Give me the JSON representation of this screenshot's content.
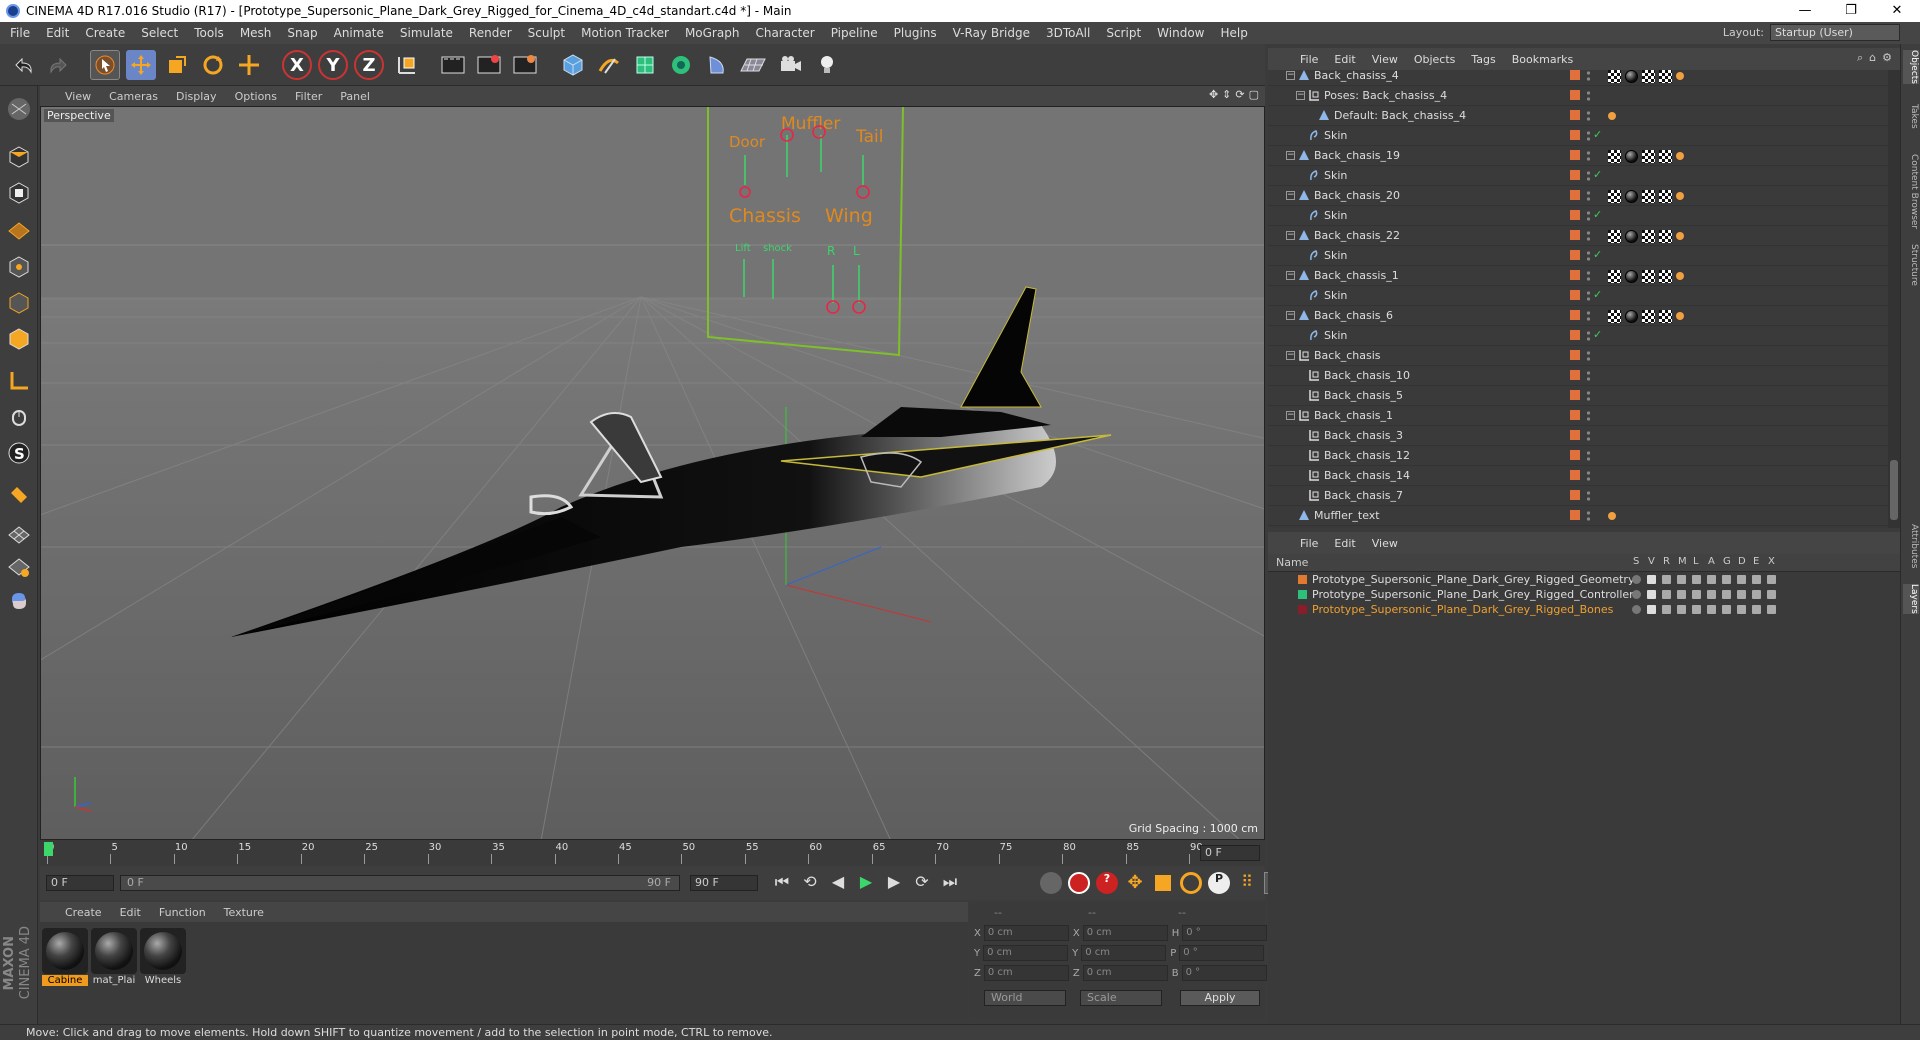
{
  "window": {
    "title": "CINEMA 4D R17.016 Studio (R17) - [Prototype_Supersonic_Plane_Dark_Grey_Rigged_for_Cinema_4D_c4d_standart.c4d *] - Main",
    "minimize": "—",
    "restore": "❐",
    "close": "✕"
  },
  "menubar": {
    "items": [
      "File",
      "Edit",
      "Create",
      "Select",
      "Tools",
      "Mesh",
      "Snap",
      "Animate",
      "Simulate",
      "Render",
      "Sculpt",
      "Motion Tracker",
      "MoGraph",
      "Character",
      "Pipeline",
      "Plugins",
      "V-Ray Bridge",
      "3DToAll",
      "Script",
      "Window",
      "Help"
    ],
    "layout_label": "Layout:",
    "layout_value": "Startup (User)"
  },
  "toolbar": {
    "icons": [
      "undo-icon",
      "redo-icon",
      "select-icon",
      "move-icon",
      "scale-icon",
      "rotate-icon",
      "move-add-icon",
      "x-axis-icon",
      "y-axis-icon",
      "z-axis-icon",
      "coord-system-icon",
      "render-view-icon",
      "render-picture-viewer-icon",
      "edit-render-settings-icon",
      "cube-icon",
      "pen-icon",
      "subdivision-icon",
      "cloner-icon",
      "deformer-icon",
      "floor-icon",
      "camera-icon",
      "light-icon"
    ],
    "axis_labels": [
      "X",
      "Y",
      "Z"
    ]
  },
  "viewport": {
    "menu": [
      "View",
      "Cameras",
      "Display",
      "Options",
      "Filter",
      "Panel"
    ],
    "label": "Perspective",
    "grid_spacing": "Grid Spacing : 1000 cm",
    "control_labels": {
      "muffler": "Muffler",
      "door": "Door",
      "tail": "Tail",
      "chassis": "Chassis",
      "wing": "Wing",
      "lift": "Lift",
      "shock": "shock",
      "r": "R",
      "l": "L"
    }
  },
  "timeline": {
    "ticks": [
      "0",
      "5",
      "10",
      "15",
      "20",
      "25",
      "30",
      "35",
      "40",
      "45",
      "50",
      "55",
      "60",
      "65",
      "70",
      "75",
      "80",
      "85",
      "90"
    ],
    "current_frame": "0 F",
    "start": "0 F",
    "range_start": "0 F",
    "range_end": "90 F",
    "end": "90 F"
  },
  "materials": {
    "menu": [
      "Create",
      "Edit",
      "Function",
      "Texture"
    ],
    "items": [
      {
        "label": "Cabine",
        "selected": true
      },
      {
        "label": "mat_Plai",
        "selected": false
      },
      {
        "label": "Wheels",
        "selected": false
      }
    ]
  },
  "coords": {
    "headers": [
      "--",
      "--",
      "--"
    ],
    "rows": [
      {
        "a": "X",
        "av": "0 cm",
        "b": "X",
        "bv": "0 cm",
        "c": "H",
        "cv": "0 °"
      },
      {
        "a": "Y",
        "av": "0 cm",
        "b": "Y",
        "bv": "0 cm",
        "c": "P",
        "cv": "0 °"
      },
      {
        "a": "Z",
        "av": "0 cm",
        "b": "Z",
        "bv": "0 cm",
        "c": "B",
        "cv": "0 °"
      }
    ],
    "mode1": "World",
    "mode2": "Scale",
    "apply": "Apply"
  },
  "status": "Move: Click and drag to move elements. Hold down SHIFT to quantize movement / add to the selection in point mode, CTRL to remove.",
  "maxon": "MAXON",
  "cinema": "CINEMA 4D",
  "objects": {
    "menu": [
      "File",
      "Edit",
      "View",
      "Objects",
      "Tags",
      "Bookmarks"
    ],
    "rows": [
      {
        "name": "Back_chasiss_4",
        "indent": 1,
        "type": "bone",
        "tags": "full",
        "check": false,
        "exp": "-"
      },
      {
        "name": "Poses: Back_chasiss_4",
        "indent": 2,
        "type": "null",
        "tags": "",
        "check": false,
        "exp": "-"
      },
      {
        "name": "Default: Back_chasiss_4",
        "indent": 3,
        "type": "bone",
        "tags": "or",
        "check": false,
        "exp": ""
      },
      {
        "name": "Skin",
        "indent": 2,
        "type": "skin",
        "tags": "",
        "check": true,
        "exp": ""
      },
      {
        "name": "Back_chasis_19",
        "indent": 1,
        "type": "bone",
        "tags": "full",
        "check": false,
        "exp": "-"
      },
      {
        "name": "Skin",
        "indent": 2,
        "type": "skin",
        "tags": "",
        "check": true,
        "exp": ""
      },
      {
        "name": "Back_chasis_20",
        "indent": 1,
        "type": "bone",
        "tags": "full",
        "check": false,
        "exp": "-"
      },
      {
        "name": "Skin",
        "indent": 2,
        "type": "skin",
        "tags": "",
        "check": true,
        "exp": ""
      },
      {
        "name": "Back_chasis_22",
        "indent": 1,
        "type": "bone",
        "tags": "full",
        "check": false,
        "exp": "-"
      },
      {
        "name": "Skin",
        "indent": 2,
        "type": "skin",
        "tags": "",
        "check": true,
        "exp": ""
      },
      {
        "name": "Back_chassis_1",
        "indent": 1,
        "type": "bone",
        "tags": "full",
        "check": false,
        "exp": "-"
      },
      {
        "name": "Skin",
        "indent": 2,
        "type": "skin",
        "tags": "",
        "check": true,
        "exp": ""
      },
      {
        "name": "Back_chasis_6",
        "indent": 1,
        "type": "bone",
        "tags": "full",
        "check": false,
        "exp": "-"
      },
      {
        "name": "Skin",
        "indent": 2,
        "type": "skin",
        "tags": "",
        "check": true,
        "exp": ""
      },
      {
        "name": "Back_chasis",
        "indent": 1,
        "type": "null",
        "tags": "",
        "check": false,
        "exp": "-"
      },
      {
        "name": "Back_chasis_10",
        "indent": 2,
        "type": "null",
        "tags": "",
        "check": false,
        "exp": ""
      },
      {
        "name": "Back_chasis_5",
        "indent": 2,
        "type": "null",
        "tags": "",
        "check": false,
        "exp": ""
      },
      {
        "name": "Back_chasis_1",
        "indent": 1,
        "type": "null",
        "tags": "",
        "check": false,
        "exp": "-"
      },
      {
        "name": "Back_chasis_3",
        "indent": 2,
        "type": "null",
        "tags": "",
        "check": false,
        "exp": ""
      },
      {
        "name": "Back_chasis_12",
        "indent": 2,
        "type": "null",
        "tags": "",
        "check": false,
        "exp": ""
      },
      {
        "name": "Back_chasis_14",
        "indent": 2,
        "type": "null",
        "tags": "",
        "check": false,
        "exp": ""
      },
      {
        "name": "Back_chasis_7",
        "indent": 2,
        "type": "null",
        "tags": "",
        "check": false,
        "exp": ""
      },
      {
        "name": "Muffler_text",
        "indent": 1,
        "type": "bone",
        "tags": "or",
        "check": false,
        "exp": ""
      }
    ]
  },
  "layers": {
    "menu": [
      "File",
      "Edit",
      "View"
    ],
    "header_name": "Name",
    "header_cols": [
      "S",
      "V",
      "R",
      "M",
      "L",
      "A",
      "G",
      "D",
      "E",
      "X"
    ],
    "rows": [
      {
        "name": "Prototype_Supersonic_Plane_Dark_Grey_Rigged_Geometry",
        "color": "#e07a30",
        "text": "#dddddd"
      },
      {
        "name": "Prototype_Supersonic_Plane_Dark_Grey_Rigged_Controllers",
        "color": "#2ec07a",
        "text": "#dddddd"
      },
      {
        "name": "Prototype_Supersonic_Plane_Dark_Grey_Rigged_Bones",
        "color": "#8a1d2a",
        "text": "#f0a030"
      }
    ]
  },
  "sidetabs": [
    "Objects",
    "Takes",
    "Content Browser",
    "Structure",
    "Attributes",
    "Layers"
  ],
  "colors": {
    "accent": "#f09a1e",
    "selected_layer_text": "#f0a030",
    "check": "#3ccf55"
  }
}
